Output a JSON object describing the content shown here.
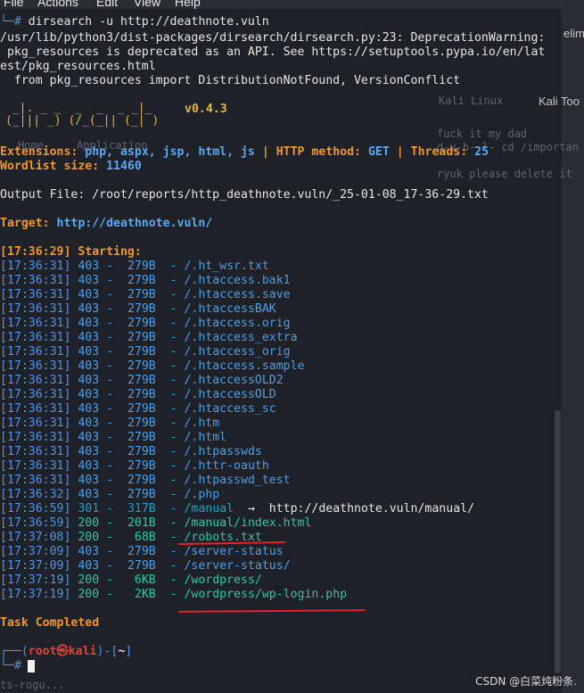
{
  "menubar": {
    "items": [
      "File",
      "Actions",
      "Edit",
      "View",
      "Help"
    ]
  },
  "command": {
    "prompt_symbol": "└─#",
    "text": " dirsearch -u http://deathnote.vuln"
  },
  "warning": {
    "line1": "/usr/lib/python3/dist-packages/dirsearch/dirsearch.py:23: DeprecationWarning:",
    "line2": " pkg_resources is deprecated as an API. See https://setuptools.pypa.io/en/lat",
    "line3": "est/pkg_resources.html",
    "line4": "  from pkg_resources import DistributionNotFound, VersionConflict"
  },
  "banner": {
    "art_line1": " _|. _ _  _  _  _ _|_",
    "art_line2": "(_||| _) (/_(_|| (_| )",
    "version": "v0.4.3"
  },
  "config": {
    "extensions_label": "Extensions:",
    "extensions_value": "php, aspx, jsp, html, js",
    "sep": "|",
    "method_label": "HTTP method:",
    "method_value": "GET",
    "threads_label": "Threads:",
    "threads_value": "25",
    "wordlist_label": "Wordlist size:",
    "wordlist_value": "11460"
  },
  "output_file": "Output File: /root/reports/http_deathnote.vuln/_25-01-08_17-36-29.txt",
  "target": {
    "label": "Target:",
    "value": "http://deathnote.vuln/"
  },
  "starting": "[17:36:29] Starting:",
  "results": [
    {
      "time": "[17:36:31]",
      "code": "403",
      "size": "279B",
      "path": "/.ht_wsr.txt",
      "redirect": ""
    },
    {
      "time": "[17:36:31]",
      "code": "403",
      "size": "279B",
      "path": "/.htaccess.bak1",
      "redirect": ""
    },
    {
      "time": "[17:36:31]",
      "code": "403",
      "size": "279B",
      "path": "/.htaccess.save",
      "redirect": ""
    },
    {
      "time": "[17:36:31]",
      "code": "403",
      "size": "279B",
      "path": "/.htaccessBAK",
      "redirect": ""
    },
    {
      "time": "[17:36:31]",
      "code": "403",
      "size": "279B",
      "path": "/.htaccess.orig",
      "redirect": ""
    },
    {
      "time": "[17:36:31]",
      "code": "403",
      "size": "279B",
      "path": "/.htaccess_extra",
      "redirect": ""
    },
    {
      "time": "[17:36:31]",
      "code": "403",
      "size": "279B",
      "path": "/.htaccess_orig",
      "redirect": ""
    },
    {
      "time": "[17:36:31]",
      "code": "403",
      "size": "279B",
      "path": "/.htaccess.sample",
      "redirect": ""
    },
    {
      "time": "[17:36:31]",
      "code": "403",
      "size": "279B",
      "path": "/.htaccessOLD2",
      "redirect": ""
    },
    {
      "time": "[17:36:31]",
      "code": "403",
      "size": "279B",
      "path": "/.htaccessOLD",
      "redirect": ""
    },
    {
      "time": "[17:36:31]",
      "code": "403",
      "size": "279B",
      "path": "/.htaccess_sc",
      "redirect": ""
    },
    {
      "time": "[17:36:31]",
      "code": "403",
      "size": "279B",
      "path": "/.htm",
      "redirect": ""
    },
    {
      "time": "[17:36:31]",
      "code": "403",
      "size": "279B",
      "path": "/.html",
      "redirect": ""
    },
    {
      "time": "[17:36:31]",
      "code": "403",
      "size": "279B",
      "path": "/.htpasswds",
      "redirect": ""
    },
    {
      "time": "[17:36:31]",
      "code": "403",
      "size": "279B",
      "path": "/.httr-oauth",
      "redirect": ""
    },
    {
      "time": "[17:36:31]",
      "code": "403",
      "size": "279B",
      "path": "/.htpasswd_test",
      "redirect": ""
    },
    {
      "time": "[17:36:32]",
      "code": "403",
      "size": "279B",
      "path": "/.php",
      "redirect": ""
    },
    {
      "time": "[17:36:59]",
      "code": "301",
      "size": "317B",
      "path": "/manual",
      "redirect": "  →  http://deathnote.vuln/manual/"
    },
    {
      "time": "[17:36:59]",
      "code": "200",
      "size": "201B",
      "path": "/manual/index.html",
      "redirect": ""
    },
    {
      "time": "[17:37:08]",
      "code": "200",
      "size": "68B",
      "path": "/robots.txt",
      "redirect": ""
    },
    {
      "time": "[17:37:09]",
      "code": "403",
      "size": "279B",
      "path": "/server-status",
      "redirect": ""
    },
    {
      "time": "[17:37:09]",
      "code": "403",
      "size": "279B",
      "path": "/server-status/",
      "redirect": ""
    },
    {
      "time": "[17:37:19]",
      "code": "200",
      "size": "6KB",
      "path": "/wordpress/",
      "redirect": ""
    },
    {
      "time": "[17:37:19]",
      "code": "200",
      "size": "2KB",
      "path": "/wordpress/wp-login.php",
      "redirect": ""
    }
  ],
  "task_completed": "Task Completed",
  "prompt": {
    "open": "┌──(",
    "user": "root㉿kali",
    "mid": ")-[",
    "dir": "~",
    "close": "]",
    "line2": "└─#"
  },
  "background_window": {
    "tab1": "elim",
    "tab2": "Kali Linux",
    "tab3": "Kali Too",
    "note1": "fuck it my dad",
    "note2": "d-v-b--l- cd /importan",
    "note3": "ryuk please delete it",
    "ghost1": "Home",
    "ghost2": "Application",
    "ghost3": "ts-rogu..."
  },
  "watermark": "CSDN @白菜炖粉条.",
  "colors": {
    "background": "#1f2129",
    "timestamp": "#5294e2",
    "status_200": "#2fc8a3",
    "annotation": "#e3222b"
  }
}
